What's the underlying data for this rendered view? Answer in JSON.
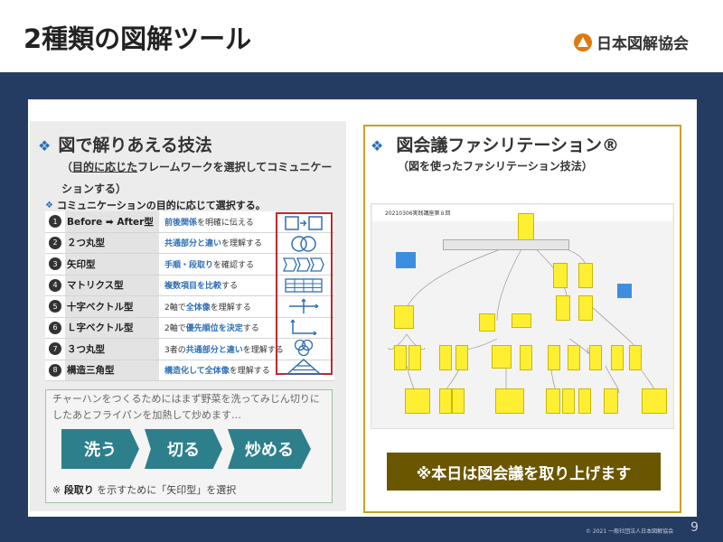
{
  "header": {
    "title": "2種類の図解ツール",
    "logo_text": "日本図解協会"
  },
  "left": {
    "bullet": "❖",
    "heading": "図で解りあえる技法",
    "sub_open": "（",
    "sub_underlined": "目的に応じた",
    "sub_rest": "フレームワークを選択してコミュニケーションする）",
    "table_title": "コミュニケーションの目的に応じて選択する。",
    "rows": [
      {
        "num": "1",
        "name": "Before ➡ After型",
        "desc_b": "前後関係",
        "desc": "を明確に伝える"
      },
      {
        "num": "2",
        "name": "２つ丸型",
        "desc_b": "共通部分と違い",
        "desc": "を理解する"
      },
      {
        "num": "3",
        "name": "矢印型",
        "desc_b": "手順・段取り",
        "desc": "を確認する"
      },
      {
        "num": "4",
        "name": "マトリクス型",
        "desc_b": "複数項目を比較",
        "desc": "する"
      },
      {
        "num": "5",
        "name": "十字ベクトル型",
        "desc_pre": "2軸で",
        "desc_b": "全体像",
        "desc": "を理解する"
      },
      {
        "num": "6",
        "name": "Ｌ字ベクトル型",
        "desc_pre": "2軸で",
        "desc_b": "優先順位を決定",
        "desc": "する"
      },
      {
        "num": "7",
        "name": "３つ丸型",
        "desc_pre": "3者の",
        "desc_b": "共通部分と違い",
        "desc": "を理解する"
      },
      {
        "num": "8",
        "name": "構造三角型",
        "desc_b": "構造化して全体像",
        "desc": "を理解する"
      }
    ],
    "example_text": "チャーハンをつくるためにはまず野菜を洗ってみじん切りにしたあとフライパンを加熱して炒めます…",
    "arrows": [
      "洗う",
      "切る",
      "炒める"
    ],
    "note_pre": "※",
    "note_b": "段取り",
    "note_rest": "を示すために「矢印型」を選択"
  },
  "right": {
    "bullet": "❖",
    "heading": "図会議ファシリテーション®",
    "sub": "（図を使ったファシリテーション技法）",
    "shot_label": "20210306実践講座第８回",
    "banner": "※本日は図会議を取り上げます"
  },
  "footer": {
    "copyright": "© 2021 一般社団法人日本図解協会",
    "page": "9"
  },
  "colors": {
    "navy": "#243c62",
    "teal": "#2d7f8c",
    "gold": "#c9a227",
    "red": "#c0282d",
    "sticky": "#ffef33"
  }
}
